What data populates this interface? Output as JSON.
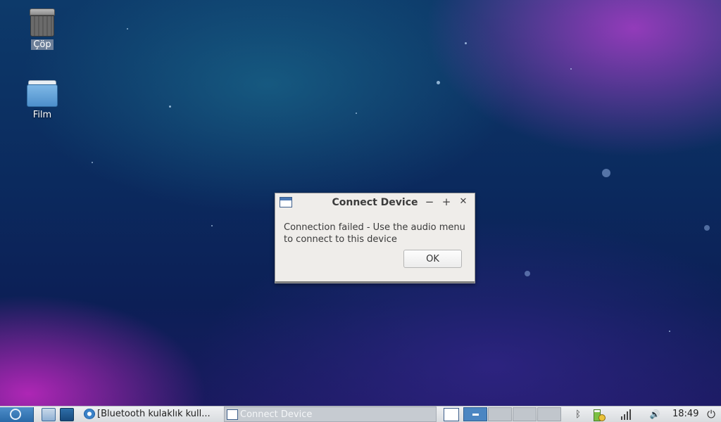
{
  "desktop": {
    "icons": [
      {
        "label": "Çöp"
      },
      {
        "label": "Film"
      }
    ]
  },
  "dialog": {
    "title": "Connect Device",
    "minimize_glyph": "−",
    "maximize_glyph": "+",
    "close_glyph": "✕",
    "message": "Connection failed - Use the audio menu to connect to this device",
    "ok_label": "OK"
  },
  "taskbar": {
    "tasks": [
      {
        "label": "[Bluetooth kulaklık kull..."
      },
      {
        "label": "Connect Device"
      }
    ],
    "tray": {
      "bluetooth_glyph": "ᛒ",
      "volume_glyph": "🔊",
      "power_glyph": "⏻"
    },
    "clock": "18:49"
  },
  "colors": {
    "accent": "#2a6aa8",
    "dialog_bg": "#efedea",
    "taskbar_bg": "#dfe2e5"
  }
}
